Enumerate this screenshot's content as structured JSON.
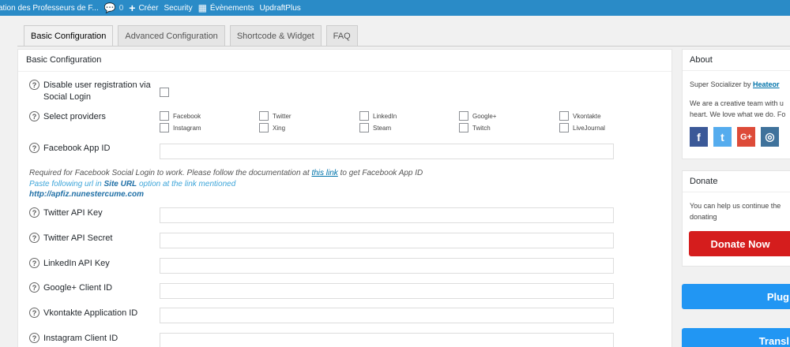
{
  "adminbar": {
    "site_name": "ation des Professeurs de F...",
    "comments_count": "0",
    "new_label": "Créer",
    "security_label": "Security",
    "events_label": "Évènements",
    "updraft_label": "UpdraftPlus"
  },
  "tabs": [
    "Basic Configuration",
    "Advanced Configuration",
    "Shortcode & Widget",
    "FAQ"
  ],
  "main": {
    "title": "Basic Configuration",
    "disable_reg_label_1": "Disable user registration via",
    "disable_reg_label_2": "Social Login",
    "select_providers_label": "Select providers",
    "providers": [
      "Facebook",
      "Twitter",
      "LinkedIn",
      "Google+",
      "Vkontakte",
      "Instagram",
      "Xing",
      "Steam",
      "Twitch",
      "LiveJournal"
    ],
    "fb_app_id_label": "Facebook App ID",
    "fb_note_prefix": "Required for Facebook Social Login to work. Please follow the documentation at ",
    "fb_note_link": "this link",
    "fb_note_suffix": " to get Facebook App ID",
    "paste_prefix": "Paste following url in ",
    "paste_bold": "Site URL",
    "paste_suffix": " option at the link mentioned",
    "site_url": "http://apfiz.nunestercume.com",
    "twitter_key_label": "Twitter API Key",
    "twitter_secret_label": "Twitter API Secret",
    "linkedin_key_label": "LinkedIn API Key",
    "google_client_label": "Google+ Client ID",
    "vk_app_label": "Vkontakte Application ID",
    "instagram_client_label": "Instagram Client ID"
  },
  "sidebar": {
    "about_title": "About",
    "about_line_prefix": "Super Socializer",
    "about_by": " by ",
    "about_author": "Heateor",
    "about_desc_1": "We are a creative team with u",
    "about_desc_2": "heart. We love what we do. Fo",
    "social": [
      {
        "icon": "facebook-icon",
        "glyph": "f",
        "color": "#3b5998"
      },
      {
        "icon": "twitter-icon",
        "glyph": "t",
        "color": "#55acee"
      },
      {
        "icon": "google-plus-icon",
        "glyph": "G+",
        "color": "#dd4b39"
      },
      {
        "icon": "instagram-icon",
        "glyph": "◎",
        "color": "#3f729b"
      }
    ],
    "donate_title": "Donate",
    "donate_desc_1": "You can help us continue the",
    "donate_desc_2": "donating",
    "donate_button": "Donate Now",
    "plugin_button": "Plug",
    "translate_button": "Transl"
  }
}
